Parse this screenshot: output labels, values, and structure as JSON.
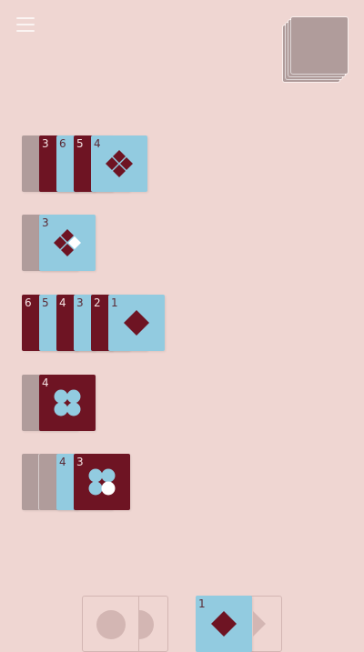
{
  "colors": {
    "background": "#efd6d2",
    "red": "#6e1423",
    "blue": "#92cbe0",
    "grey": "#b09c9b",
    "white": "#ffffff"
  },
  "icons": {
    "menu": "hamburger-menu-icon",
    "deck": "draw-pile-stack"
  },
  "rows": [
    {
      "cards": [
        {
          "color": "grey",
          "num": ""
        },
        {
          "color": "red",
          "num": "3"
        },
        {
          "color": "blue",
          "num": "6"
        },
        {
          "color": "red",
          "num": "5"
        },
        {
          "color": "blue",
          "num": "4"
        }
      ],
      "face": "four-red-diamonds"
    },
    {
      "cards": [
        {
          "color": "grey",
          "num": ""
        },
        {
          "color": "blue",
          "num": "3"
        }
      ],
      "face": "three-red-diamonds-one-white"
    },
    {
      "cards": [
        {
          "color": "red",
          "num": "6"
        },
        {
          "color": "blue",
          "num": "5"
        },
        {
          "color": "red",
          "num": "4"
        },
        {
          "color": "blue",
          "num": "3"
        },
        {
          "color": "red",
          "num": "2"
        },
        {
          "color": "blue",
          "num": "1"
        }
      ],
      "face": "one-red-diamond"
    },
    {
      "cards": [
        {
          "color": "grey",
          "num": ""
        },
        {
          "color": "red",
          "num": "4"
        }
      ],
      "face": "four-blue-circles"
    },
    {
      "cards": [
        {
          "color": "grey",
          "num": ""
        },
        {
          "color": "grey",
          "num": ""
        },
        {
          "color": "blue",
          "num": "4"
        },
        {
          "color": "red",
          "num": "3"
        }
      ],
      "face": "three-blue-circles-one-white"
    }
  ],
  "bottom": {
    "left_slot": {
      "icon": "grey-circle-icon"
    },
    "right_slot": {
      "num": "1",
      "icon": "red-diamond-icon"
    }
  }
}
